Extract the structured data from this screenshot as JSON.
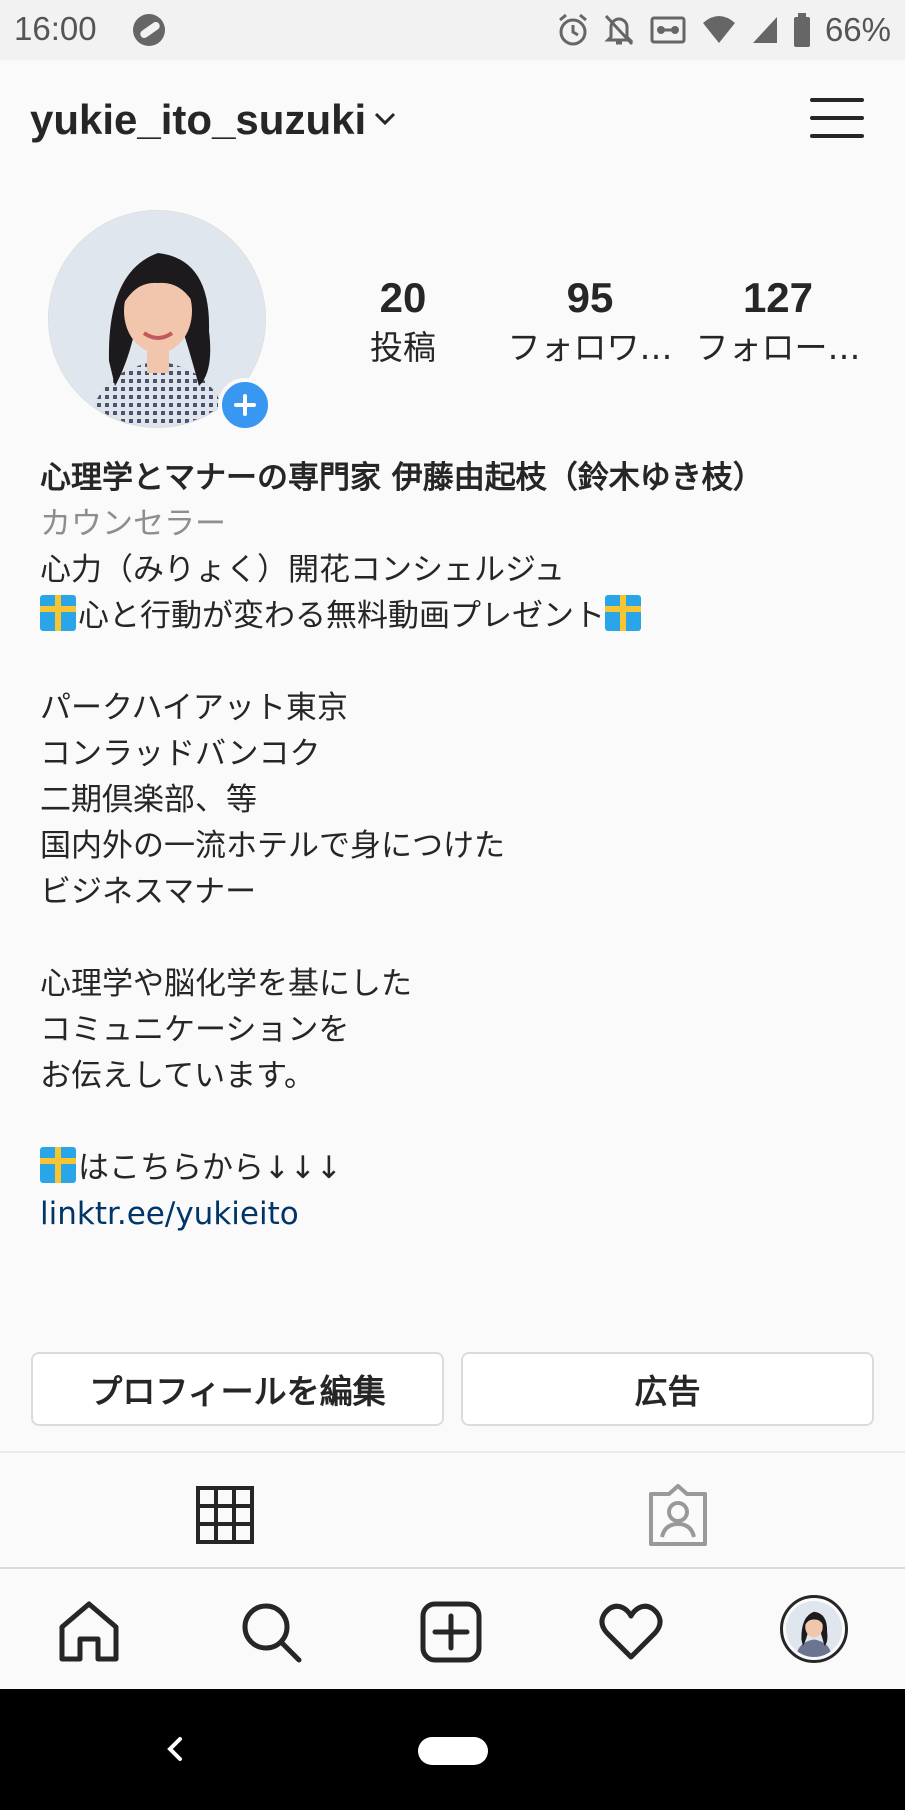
{
  "status_bar": {
    "time": "16:00",
    "battery_percent": "66%",
    "icons": [
      "app-icon",
      "alarm-icon",
      "notifications-off-icon",
      "cast-icon",
      "wifi-icon",
      "signal-icon",
      "battery-icon"
    ]
  },
  "header": {
    "username": "yukie_ito_suzuki"
  },
  "stats": {
    "posts_count": "20",
    "posts_label": "投稿",
    "followers_count": "95",
    "followers_label": "フォロワ…",
    "following_count": "127",
    "following_label": "フォロー…"
  },
  "bio": {
    "name": "心理学とマナーの専門家 伊藤由起枝（鈴木ゆき枝）",
    "category": "カウンセラー",
    "line1": "心力（みりょく）開花コンシェルジュ",
    "line2": "心と行動が変わる無料動画プレゼント",
    "line3": "パークハイアット東京",
    "line4": "コンラッドバンコク",
    "line5": "二期倶楽部、等",
    "line6": "国内外の一流ホテルで身につけた",
    "line7": "ビジネスマナー",
    "line8": "心理学や脳化学を基にした",
    "line9": "コミュニケーションを",
    "line10": "お伝えしています。",
    "line11": "はこちらから↓↓↓",
    "link": "linktr.ee/yukieito"
  },
  "buttons": {
    "edit_profile": "プロフィールを編集",
    "ads": "広告"
  },
  "tabs": [
    "grid-icon",
    "tagged-icon"
  ],
  "bottom_nav": [
    "home-icon",
    "search-icon",
    "add-post-icon",
    "heart-icon",
    "profile-avatar"
  ],
  "colors": {
    "accent_blue": "#3897f0",
    "link": "#003569",
    "text": "#262626",
    "muted": "#8e8e8e"
  }
}
